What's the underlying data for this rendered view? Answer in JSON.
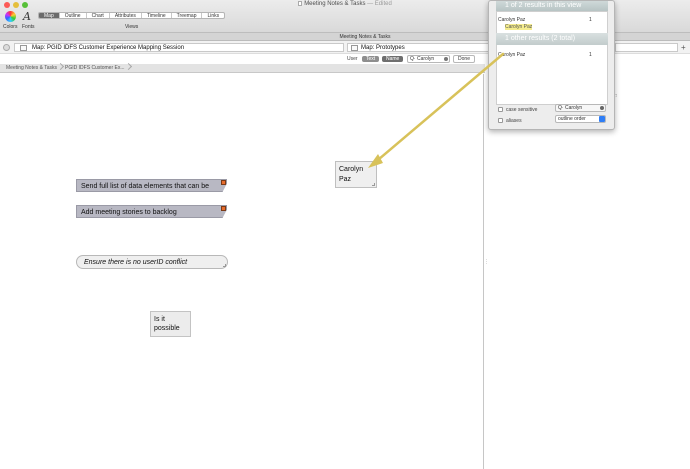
{
  "window": {
    "title": "Meeting Notes & Tasks",
    "edited": "— Edited"
  },
  "toolbar": {
    "colors_label": "Colors",
    "fonts_label": "Fonts",
    "views_label": "Views",
    "views": [
      "Map",
      "Outline",
      "Chart",
      "Attributes",
      "Timeline",
      "Treemap",
      "Links"
    ],
    "active_view": "Map"
  },
  "tab": {
    "label": "Meeting Notes & Tasks"
  },
  "map_header": {
    "primary": "Map: PGID IDFS Customer Experience Mapping Session",
    "secondary": "Map: Prototypes"
  },
  "find": {
    "user_label": "User",
    "text_label": "Text",
    "name_label": "Name",
    "query": "Carolyn",
    "done_label": "Done"
  },
  "breadcrumb": [
    "Meeting Notes & Tasks",
    "PGID IDFS Customer Ex..."
  ],
  "notes": {
    "a": "Send full list of data elements that can be",
    "b": "Add meeting stories to backlog",
    "c": "Ensure there is no userID conflict",
    "d_line1": "Is it",
    "d_line2": "possible",
    "e_line1": "Carolyn",
    "e_line2": "Paz"
  },
  "popover": {
    "header": "1 of 2 results in this view",
    "result1_name": "Carolyn Paz",
    "result1_count": "1",
    "result1_snippet": "Carolyn Paz",
    "other_header": "1 other results (2 total)",
    "result2_name": "Carolyn Paz",
    "result2_count": "1",
    "case_sensitive": "case sensitive",
    "aliases": "aliases",
    "search_value": "Carolyn",
    "order_value": "outline order"
  },
  "colors": {
    "note_fill": "#b8b8c3",
    "arrow": "#d8c25a",
    "flag": "#e86c2c"
  }
}
